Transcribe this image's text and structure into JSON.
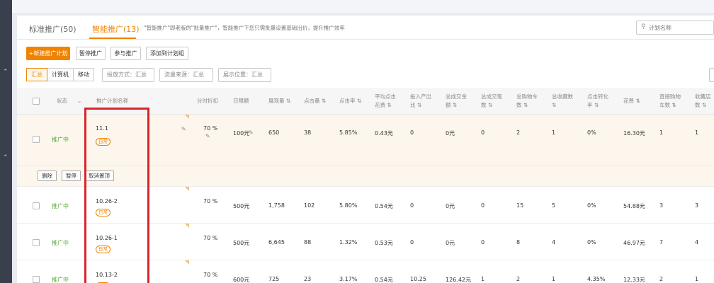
{
  "tabs": [
    {
      "label": "标准推广(50)"
    },
    {
      "label": "智能推广(13)"
    }
  ],
  "tab_note": "\"智能推广\"即老版的\"批量推广\"，智能推广下您只需批量设置基础出价，提升推广效率",
  "search": {
    "placeholder": "计划名称"
  },
  "toolbar": {
    "new_plan": "+新建推广计划",
    "pause": "暂停推广",
    "join": "参与推广",
    "add_group": "添加到计划组"
  },
  "filter_seg": [
    "汇总",
    "计算机",
    "移动"
  ],
  "filters": {
    "placement": "投放方式：汇总",
    "traffic": "流量来源：汇总",
    "position": "展示位置：汇总"
  },
  "columns": {
    "status": "状态",
    "name": "推广计划名称",
    "discount": "分时折扣",
    "budget": "日限额",
    "impressions": "展现量 ⇅",
    "clicks": "点击量 ⇅",
    "ctr": "点击率 ⇅",
    "avg_cpc_1": "平均点击",
    "avg_cpc_2": "花费 ⇅",
    "roi_1": "投入产出",
    "roi_2": "比 ⇅",
    "gmv_1": "总成交金",
    "gmv_2": "额 ⇅",
    "orders_1": "总成交笔",
    "orders_2": "数 ⇅",
    "cart_1": "总购物车",
    "cart_2": "数 ⇅",
    "fav_1": "总收藏数",
    "fav_2": "⇅",
    "cvr_1": "点击转化",
    "cvr_2": "率 ⇅",
    "cost": "花费 ⇅",
    "direct_cart_1": "直接购物",
    "direct_cart_2": "车数 ⇅",
    "fav_store_1": "收藏店",
    "fav_store_2": "数 ⇅"
  },
  "rows": [
    {
      "status": "推广中",
      "name": "11.1",
      "tag": "日常",
      "discount": "70 %",
      "budget": "100元",
      "impressions": "650",
      "clicks": "38",
      "ctr": "5.85%",
      "avg_cpc": "0.43元",
      "roi": "0",
      "gmv": "0元",
      "orders": "0",
      "cart": "2",
      "fav": "1",
      "cvr": "0%",
      "cost": "16.30元",
      "direct_cart": "1",
      "fav_store": "1"
    },
    {
      "status": "推广中",
      "name": "10.26-2",
      "tag": "日常",
      "discount": "70 %",
      "budget": "500元",
      "impressions": "1,758",
      "clicks": "102",
      "ctr": "5.80%",
      "avg_cpc": "0.54元",
      "roi": "0",
      "gmv": "0元",
      "orders": "0",
      "cart": "15",
      "fav": "5",
      "cvr": "0%",
      "cost": "54.88元",
      "direct_cart": "3",
      "fav_store": "3"
    },
    {
      "status": "推广中",
      "name": "10.26-1",
      "tag": "日常",
      "discount": "70 %",
      "budget": "500元",
      "impressions": "6,645",
      "clicks": "88",
      "ctr": "1.32%",
      "avg_cpc": "0.53元",
      "roi": "0",
      "gmv": "0元",
      "orders": "0",
      "cart": "8",
      "fav": "4",
      "cvr": "0%",
      "cost": "46.97元",
      "direct_cart": "7",
      "fav_store": "4"
    },
    {
      "status": "推广中",
      "name": "10.13-2",
      "tag": "日常",
      "discount": "70 %",
      "budget": "600元",
      "impressions": "725",
      "clicks": "23",
      "ctr": "3.17%",
      "avg_cpc": "0.54元",
      "roi": "10.25",
      "gmv": "126.42元",
      "orders": "1",
      "cart": "2",
      "fav": "1",
      "cvr": "4.35%",
      "cost": "12.33元",
      "direct_cart": "2",
      "fav_store": "1"
    }
  ],
  "row_actions": [
    "删除",
    "暂停",
    "取消置顶"
  ]
}
